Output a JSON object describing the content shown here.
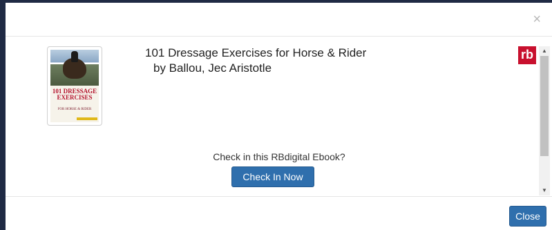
{
  "dialog": {
    "close_x": "×",
    "footer_close_label": "Close"
  },
  "book": {
    "title": "101 Dressage Exercises for Horse & Rider",
    "author_line": "by Ballou, Jec Aristotle",
    "cover": {
      "title_text": "101 DRESSAGE EXERCISES",
      "subtitle_text": "FOR HORSE & RIDER"
    }
  },
  "provider": {
    "logo_text": "rb",
    "logo_color": "#c8102e"
  },
  "action": {
    "prompt": "Check in this RBdigital Ebook?",
    "button_label": "Check In Now"
  },
  "scrollbar": {
    "up_arrow": "▲",
    "down_arrow": "▼"
  },
  "colors": {
    "primary_button": "#2f6fad",
    "backdrop": "#1f2a44"
  }
}
